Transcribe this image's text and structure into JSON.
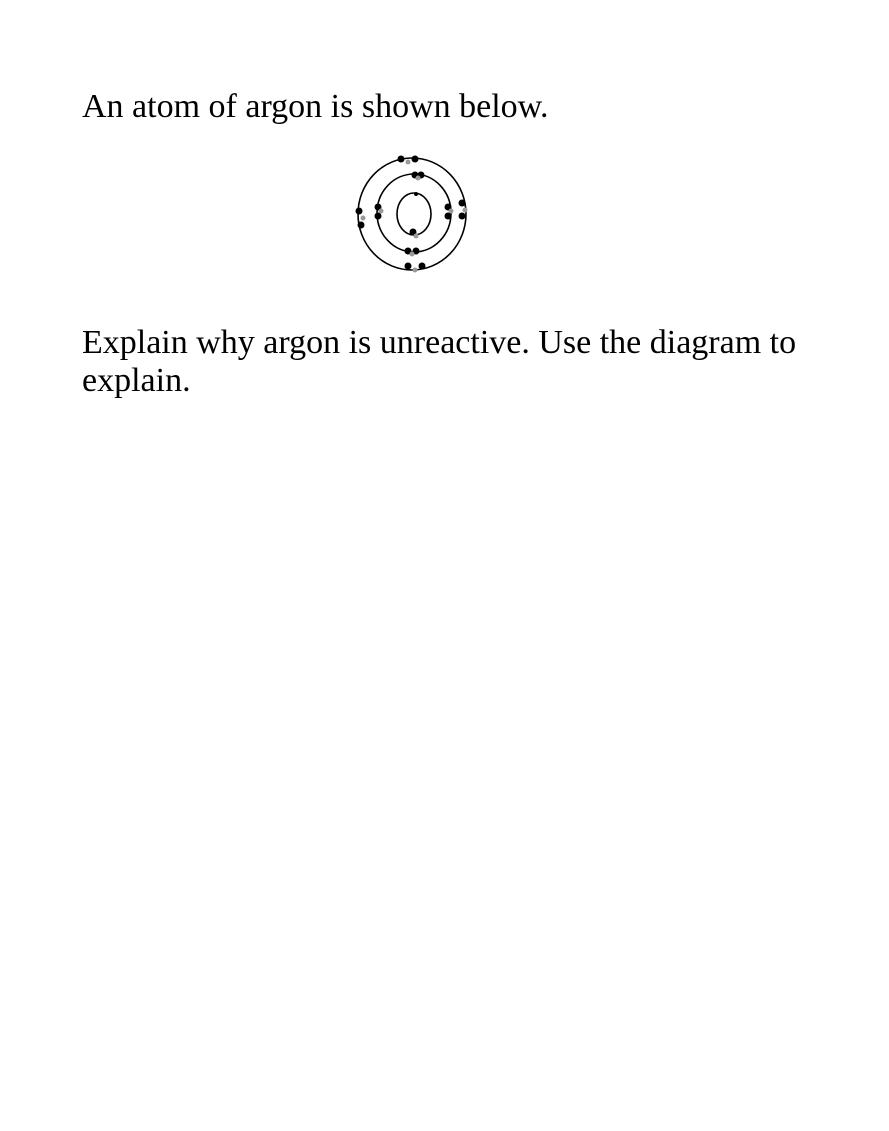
{
  "document": {
    "intro": "An atom of argon is shown below.",
    "question": "Explain why argon is unreactive. Use the diagram to explain."
  },
  "diagram": {
    "element": "argon",
    "shells": [
      {
        "name": "inner",
        "electrons": 2
      },
      {
        "name": "middle",
        "electrons": 8
      },
      {
        "name": "outer",
        "electrons": 8
      }
    ]
  }
}
